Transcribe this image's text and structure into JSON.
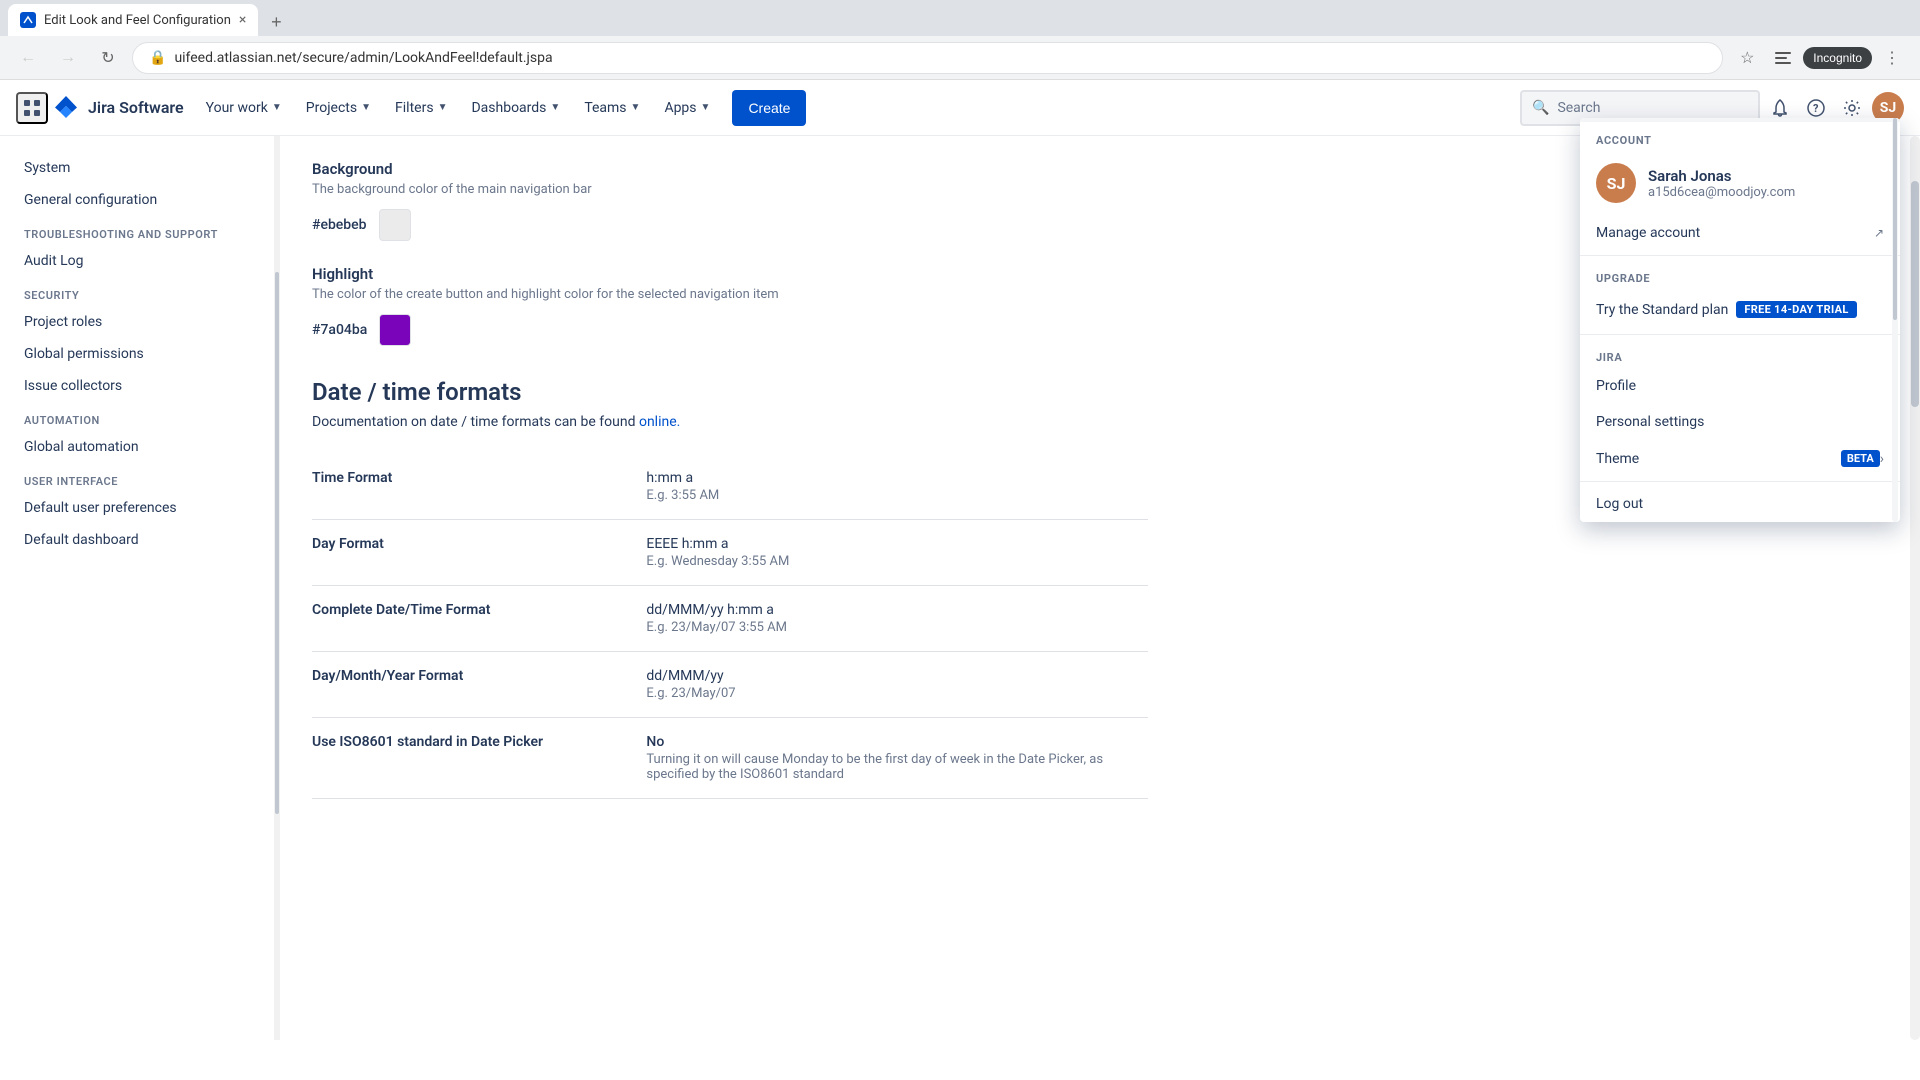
{
  "browser": {
    "tab_title": "Edit Look and Feel Configuration",
    "tab_favicon": "J",
    "address": "uifeed.atlassian.net/secure/admin/LookAndFeel!default.jspa",
    "new_tab_label": "+",
    "close_label": "×",
    "incognito_label": "Incognito"
  },
  "nav": {
    "logo_text": "Jira Software",
    "your_work": "Your work",
    "projects": "Projects",
    "filters": "Filters",
    "dashboards": "Dashboards",
    "teams": "Teams",
    "apps": "Apps",
    "create": "Create",
    "search_placeholder": "Search"
  },
  "sidebar": {
    "system": "System",
    "general_configuration": "General configuration",
    "troubleshooting_label": "Troubleshooting and Support",
    "audit_log": "Audit Log",
    "security_label": "Security",
    "project_roles": "Project roles",
    "global_permissions": "Global permissions",
    "issue_collectors": "Issue collectors",
    "automation_label": "Automation",
    "global_automation": "Global automation",
    "user_interface_label": "User Interface",
    "default_user_preferences": "Default user preferences",
    "default_dashboard": "Default dashboard"
  },
  "content": {
    "background_label": "Background",
    "background_desc": "The background color of the main navigation bar",
    "background_hex": "#ebebeb",
    "highlight_label": "Highlight",
    "highlight_desc": "The color of the create button and highlight color for the selected navigation item",
    "highlight_hex": "#7a04ba",
    "section_title": "Date / time formats",
    "section_desc_prefix": "Documentation on date / time formats can be found",
    "section_link": "online.",
    "time_format_label": "Time Format",
    "time_format_value": "h:mm a",
    "time_format_example": "E.g. 3:55 AM",
    "day_format_label": "Day Format",
    "day_format_value": "EEEE h:mm a",
    "day_format_example": "E.g. Wednesday 3:55 AM",
    "complete_format_label": "Complete Date/Time Format",
    "complete_format_value": "dd/MMM/yy h:mm a",
    "complete_format_example": "E.g. 23/May/07 3:55 AM",
    "daymonthyear_label": "Day/Month/Year Format",
    "daymonthyear_value": "dd/MMM/yy",
    "daymonthyear_example": "E.g. 23/May/07",
    "iso_label": "Use ISO8601 standard in Date Picker",
    "iso_value": "No",
    "iso_desc": "Turning it on will cause Monday to be the first day of week in the Date Picker, as specified by the ISO8601 standard"
  },
  "dropdown": {
    "account_section": "ACCOUNT",
    "user_name": "Sarah Jonas",
    "user_email": "a15d6cea@moodjoy.com",
    "manage_account": "Manage account",
    "upgrade_section": "UPGRADE",
    "upgrade_text": "Try the Standard plan",
    "trial_badge": "FREE 14-DAY TRIAL",
    "jira_section": "JIRA",
    "profile": "Profile",
    "personal_settings": "Personal settings",
    "theme": "Theme",
    "beta_badge": "BETA",
    "log_out": "Log out"
  }
}
